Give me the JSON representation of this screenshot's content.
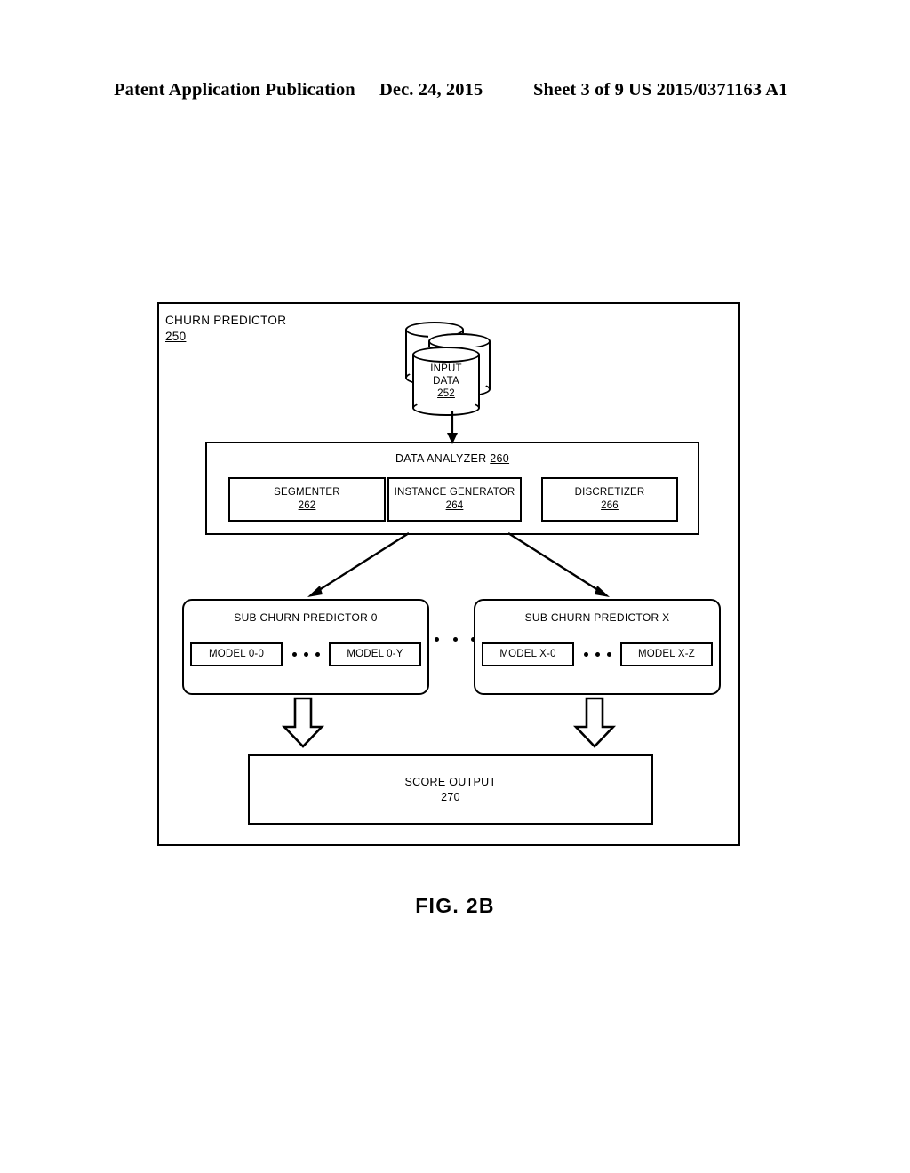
{
  "header": {
    "publication": "Patent Application Publication",
    "date": "Dec. 24, 2015",
    "sheet": "Sheet 3 of 9",
    "patent_number": "US 2015/0371163 A1"
  },
  "figure": {
    "caption": "FIG. 2B",
    "outer": {
      "title": "CHURN PREDICTOR",
      "ref": "250"
    },
    "input_data": {
      "line1": "INPUT",
      "line2": "DATA",
      "ref": "252"
    },
    "data_analyzer": {
      "title": "DATA ANALYZER",
      "ref": "260",
      "components": [
        {
          "label": "SEGMENTER",
          "ref": "262"
        },
        {
          "label": "INSTANCE GENERATOR",
          "ref": "264"
        },
        {
          "label": "DISCRETIZER",
          "ref": "266"
        }
      ]
    },
    "sub_predictors": [
      {
        "title": "SUB CHURN PREDICTOR 0",
        "models": [
          {
            "label": "MODEL 0-0"
          },
          {
            "label": "MODEL 0-Y"
          }
        ]
      },
      {
        "title": "SUB CHURN PREDICTOR X",
        "models": [
          {
            "label": "MODEL X-0"
          },
          {
            "label": "MODEL X-Z"
          }
        ]
      }
    ],
    "score_output": {
      "title": "SCORE OUTPUT",
      "ref": "270"
    }
  },
  "colors": {
    "ink": "#000000",
    "paper": "#ffffff"
  }
}
